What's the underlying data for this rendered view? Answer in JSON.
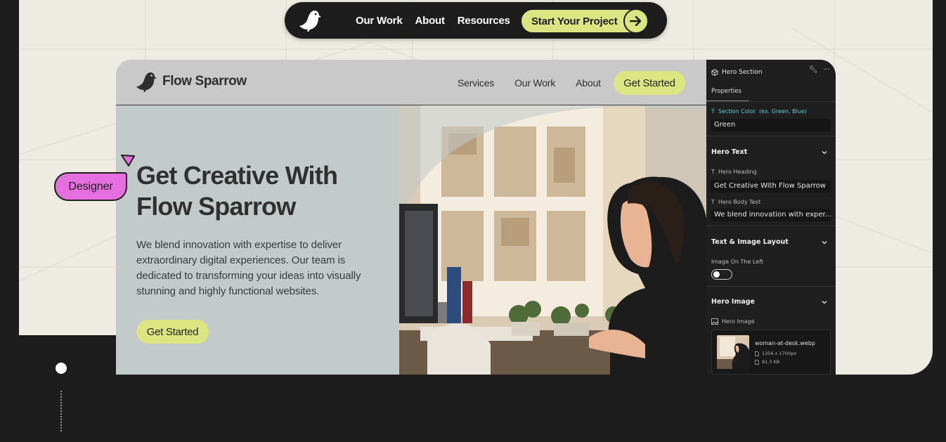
{
  "top_nav": {
    "links": [
      "Our Work",
      "About",
      "Resources"
    ],
    "cta_label": "Start Your Project",
    "cta_icon": "arrow-right-icon"
  },
  "site": {
    "brand": "Flow Sparrow",
    "nav": [
      "Services",
      "Our Work",
      "About"
    ],
    "header_cta": "Get Started",
    "hero_heading": "Get Creative With Flow Sparrow",
    "hero_body": "We blend innovation with expertise to deliver extraordinary digital experiences. Our team is dedicated to transforming your ideas into visually stunning and highly functional websites.",
    "hero_button": "Get Started",
    "accent_color": "#dbe582",
    "hero_bg_color": "#c3cbca"
  },
  "panel": {
    "title": "Hero Section",
    "tab": "Properties",
    "section_color": {
      "type_icon": "T",
      "label": "Section Color",
      "hint": "(ex. Green, Blue)",
      "value": "Green"
    },
    "hero_text": {
      "title": "Hero Text",
      "heading_label": "Hero Heading",
      "heading_value": "Get Creative With Flow Sparrow",
      "body_label": "Hero Body Text",
      "body_value": "We blend innovation with exper..."
    },
    "layout": {
      "title": "Text & Image Layout",
      "toggle_label": "Image On The Left",
      "toggle_on": false
    },
    "hero_image": {
      "title": "Hero Image",
      "label": "Hero Image",
      "file_name": "woman-at-desk.webp",
      "dimensions": "1356 x 1700px",
      "size": "91.3 KB"
    }
  },
  "designer_label": "Designer",
  "colors": {
    "canvas": "#eeebe2",
    "dark": "#1d1d1d",
    "designer_pink": "#e66fe0",
    "cyan": "#5fd5dc"
  }
}
